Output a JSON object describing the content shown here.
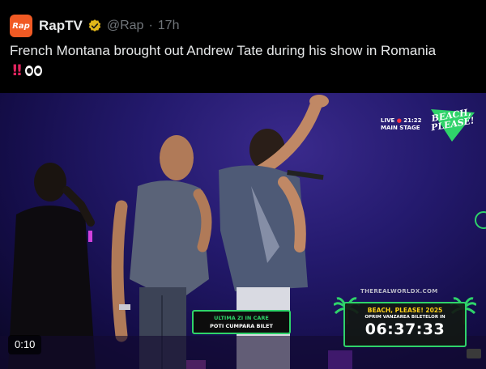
{
  "tweet": {
    "avatar_text": "Rap",
    "display_name": "RapTV",
    "handle": "@Rap",
    "separator": "·",
    "time": "17h",
    "text": "French Montana brought out Andrew Tate during his show in Romania"
  },
  "media": {
    "live_label": "LIVE",
    "clock": "21:22",
    "stage": "MAIN STAGE",
    "event_logo_line1": "BEACH,",
    "event_logo_line2": "PLEASE!",
    "watermark": "THEREALWORLDX.COM",
    "promo_line1": "ULTIMA ZI IN CARE",
    "promo_line2": "POTI CUMPARA BILET",
    "countdown_title": "BEACH, PLEASE! 2025",
    "countdown_subtitle": "OPRIM VANZAREA BILETELOR IN",
    "countdown_time": "06:37:33",
    "duration": "0:10"
  },
  "colors": {
    "brand_orange": "#f15a24",
    "verified_gold": "#e2b719",
    "accent_green": "#2fd36a",
    "bang_red": "#e0245e"
  },
  "icons": [
    "verified-badge-icon",
    "double-exclamation-emoji-icon",
    "eyes-emoji-icon",
    "palm-tree-icon"
  ]
}
